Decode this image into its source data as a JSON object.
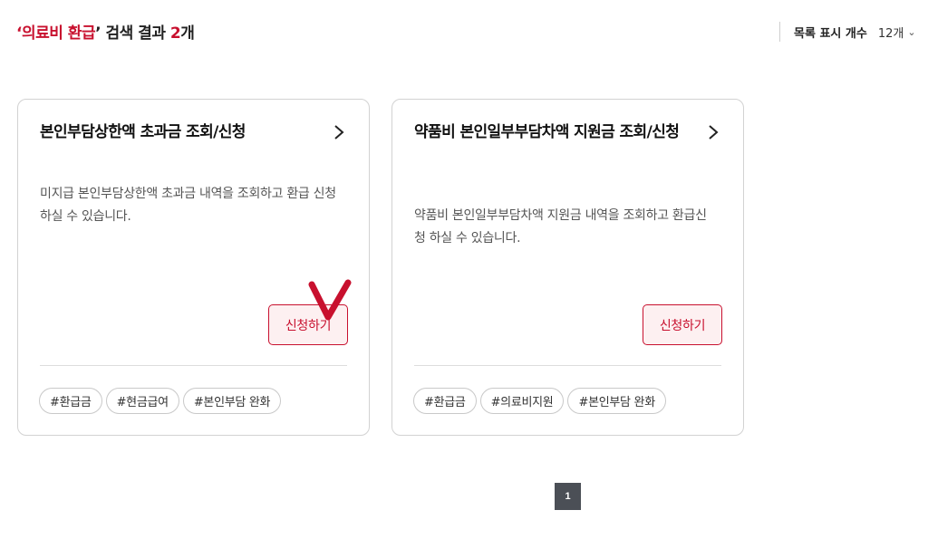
{
  "search": {
    "open_quote": "‘",
    "keyword": "의료비 환급",
    "close_quote": "’",
    "result_text": " 검색 결과 ",
    "count": "2",
    "count_unit": "개"
  },
  "list_count": {
    "label": "목록 표시 개수",
    "value": "12개"
  },
  "cards": [
    {
      "title": "본인부담상한액 초과금 조회/신청",
      "description": "미지급 본인부담상한액 초과금 내역을 조회하고 환급 신청 하실 수 있습니다.",
      "button": "신청하기",
      "tags": [
        "#환급금",
        "#현금급여",
        "#본인부담 완화"
      ]
    },
    {
      "title": "약품비 본인일부부담차액 지원금 조회/신청",
      "description": "약품비 본인일부부담차액 지원금 내역을 조회하고 환급신청 하실 수 있습니다.",
      "button": "신청하기",
      "tags": [
        "#환급금",
        "#의료비지원",
        "#본인부담 완화"
      ]
    }
  ],
  "pagination": {
    "current_page": "1"
  },
  "colors": {
    "accent": "#c8102e",
    "button_bg": "#fdf0f1",
    "page_active_bg": "#4b4f56"
  },
  "icons": {
    "card_link": "chevron-right-icon",
    "list_count_dropdown": "chevron-down-icon",
    "annotation": "check-mark-icon"
  }
}
